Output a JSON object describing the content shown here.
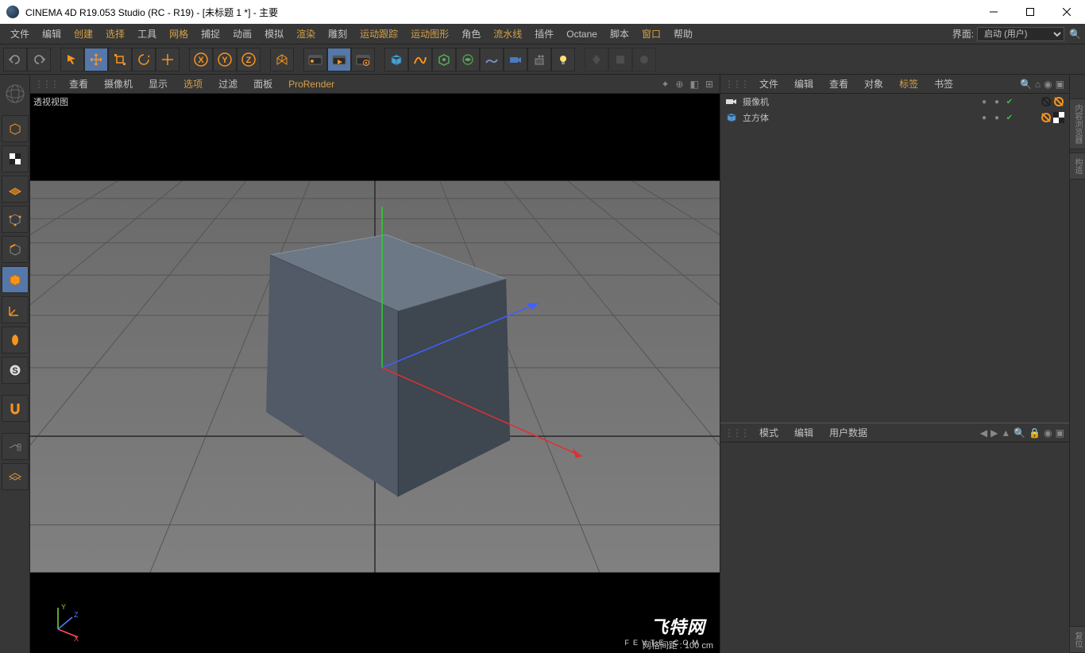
{
  "title": "CINEMA 4D R19.053 Studio (RC - R19) - [未标题 1 *] - 主要",
  "menu": {
    "items": [
      "文件",
      "编辑",
      "创建",
      "选择",
      "工具",
      "网格",
      "捕捉",
      "动画",
      "模拟",
      "渲染",
      "雕刻",
      "运动跟踪",
      "运动图形",
      "角色",
      "流水线",
      "插件",
      "Octane",
      "脚本",
      "窗口",
      "帮助"
    ],
    "orange_indices": [
      2,
      3,
      5,
      9,
      11,
      12,
      14,
      18
    ],
    "layout_label": "界面:",
    "layout_value": "启动 (用户)"
  },
  "viewport_menu": {
    "items": [
      "查看",
      "摄像机",
      "显示",
      "选项",
      "过滤",
      "面板",
      "ProRender"
    ],
    "orange_indices": [
      3,
      6
    ]
  },
  "viewport": {
    "label": "透视视图",
    "gridinfo": "网格间距 : 100 cm"
  },
  "obj_panel": {
    "menus": [
      "文件",
      "编辑",
      "查看",
      "对象",
      "标签",
      "书签"
    ],
    "orange_indices": [
      4
    ],
    "rows": [
      {
        "icon": "camera",
        "name": "摄像机",
        "vis1": true,
        "vis2": true,
        "tags": [
          "target-black",
          "target-orange"
        ]
      },
      {
        "icon": "cube",
        "name": "立方体",
        "vis1": true,
        "vis2": true,
        "tags": [
          "target-orange",
          "checker"
        ]
      }
    ]
  },
  "attr_panel": {
    "menus": [
      "模式",
      "编辑",
      "用户数据"
    ]
  },
  "watermark": {
    "brand": "飞特网",
    "domain": "FEVTE.COM"
  },
  "axis": {
    "x": "X",
    "y": "Y",
    "z": "Z"
  }
}
